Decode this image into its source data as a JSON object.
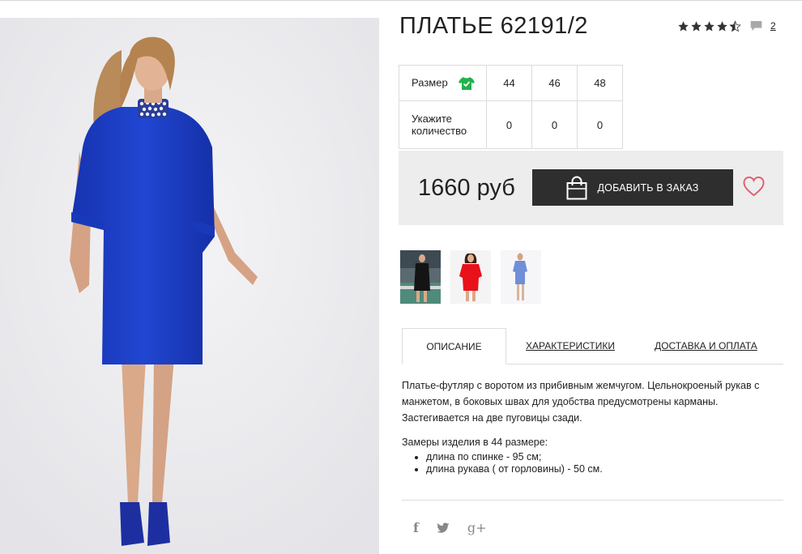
{
  "product": {
    "title": "ПЛАТЬЕ 62191/2",
    "rating": 4.5,
    "review_count": "2"
  },
  "size_table": {
    "size_label": "Размер",
    "sizes": [
      "44",
      "46",
      "48"
    ],
    "qty_label": "Укажите количество",
    "quantities": [
      "0",
      "0",
      "0"
    ]
  },
  "purchase": {
    "price": "1660 руб",
    "add_button_label": "ДОБАВИТЬ В ЗАКАЗ"
  },
  "thumbnails": [
    "black-dress-thumb",
    "red-dress-thumb",
    "blue-dress-thumb"
  ],
  "tabs": [
    {
      "label": "ОПИСАНИЕ",
      "active": true
    },
    {
      "label": "ХАРАКТЕРИСТИКИ",
      "active": false
    },
    {
      "label": "ДОСТАВКА И ОПЛАТА",
      "active": false
    }
  ],
  "description": {
    "text": "Платье-футляр с воротом из прибивным жемчугом. Цельнокроеный рукав с манжетом, в боковых швах для удобства предусмотрены карманы. Застегивается на две пуговицы сзади.",
    "measures_title": "Замеры изделия в 44 размере:",
    "measures": [
      "длина по спинке - 95 см;",
      "длина рукава ( от горловины) - 50 см."
    ]
  },
  "social": {
    "facebook": "f",
    "twitter": "twitter-icon",
    "google": "g+"
  },
  "colors": {
    "dark_button": "#2e2e2e",
    "price_bg": "#ededed",
    "heart": "#e06070",
    "size_check": "#22b14c",
    "dress_blue": "#1f3fc4"
  }
}
